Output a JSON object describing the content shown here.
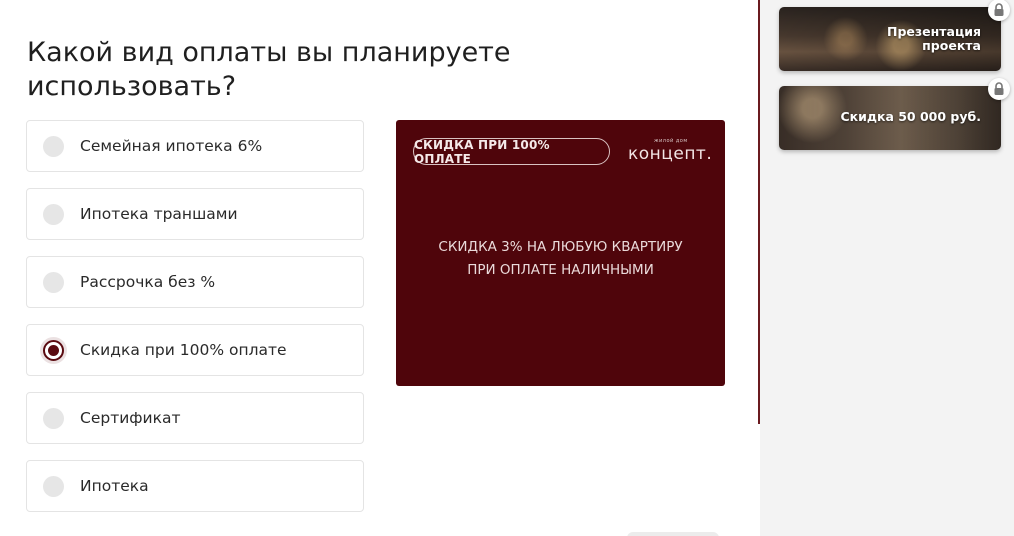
{
  "question": {
    "title": "Какой вид оплаты вы планируете использовать?"
  },
  "options": [
    {
      "label": "Семейная ипотека 6%",
      "selected": false
    },
    {
      "label": "Ипотека траншами",
      "selected": false
    },
    {
      "label": "Рассрочка без %",
      "selected": false
    },
    {
      "label": "Скидка при 100% оплате",
      "selected": true
    },
    {
      "label": "Сертификат",
      "selected": false
    },
    {
      "label": "Ипотека",
      "selected": false
    }
  ],
  "promo": {
    "badge": "СКИДКА ПРИ 100% ОПЛАТЕ",
    "logo_small": "жилой дом",
    "logo_word": "концепт.",
    "line1": "СКИДКА 3% НА ЛЮБУЮ КВАРТИРУ",
    "line2": "ПРИ ОПЛАТЕ НАЛИЧНЫМИ",
    "background_color": "#4f050b"
  },
  "sidebar": {
    "cards": [
      {
        "label_line1": "Презентация",
        "label_line2": "проекта",
        "icon": "lock-icon"
      },
      {
        "label_line1": "Скидка 50 000 руб.",
        "label_line2": "",
        "icon": "lock-icon"
      }
    ]
  },
  "colors": {
    "accent": "#5a0a10",
    "divider": "#6a1a1f"
  }
}
